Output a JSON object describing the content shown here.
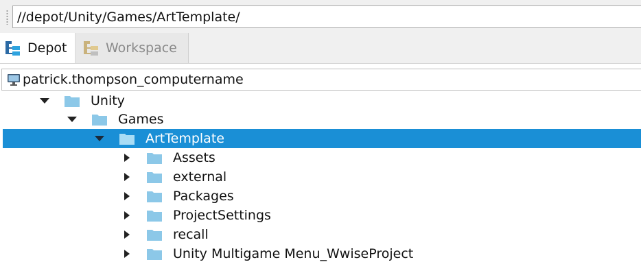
{
  "path_bar": {
    "value": "//depot/Unity/Games/ArtTemplate/"
  },
  "tabs": [
    {
      "label": "Depot",
      "icon": "depot-tree-icon",
      "active": true
    },
    {
      "label": "Workspace",
      "icon": "workspace-tree-icon",
      "active": false
    }
  ],
  "client": {
    "icon": "computer-monitor-icon",
    "name": "patrick.thompson_computername"
  },
  "tree": {
    "rows": [
      {
        "label": "Unity",
        "depth": 0,
        "expanded": true,
        "selected": false
      },
      {
        "label": "Games",
        "depth": 1,
        "expanded": true,
        "selected": false
      },
      {
        "label": "ArtTemplate",
        "depth": 2,
        "expanded": true,
        "selected": true
      },
      {
        "label": "Assets",
        "depth": 3,
        "expanded": false,
        "selected": false
      },
      {
        "label": "external",
        "depth": 3,
        "expanded": false,
        "selected": false
      },
      {
        "label": "Packages",
        "depth": 3,
        "expanded": false,
        "selected": false
      },
      {
        "label": "ProjectSettings",
        "depth": 3,
        "expanded": false,
        "selected": false
      },
      {
        "label": "recall",
        "depth": 3,
        "expanded": false,
        "selected": false
      },
      {
        "label": "Unity Multigame Menu_WwiseProject",
        "depth": 3,
        "expanded": false,
        "selected": false
      }
    ]
  },
  "colors": {
    "selection": "#1a8fd6",
    "folder": "#8cc8e8",
    "folder_selected": "#a9dcf5"
  }
}
